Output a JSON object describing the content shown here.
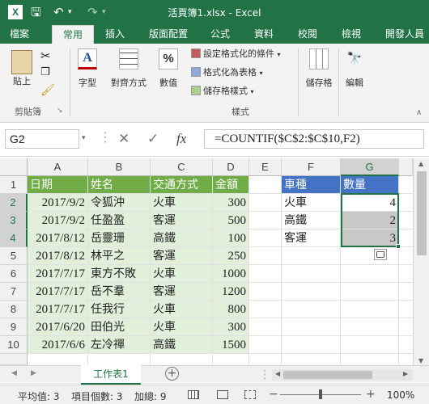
{
  "window": {
    "title": "活頁簿1.xlsx - Excel",
    "app_icon": "X"
  },
  "ribbon_tabs": [
    {
      "label": "檔案"
    },
    {
      "label": "常用"
    },
    {
      "label": "插入"
    },
    {
      "label": "版面配置"
    },
    {
      "label": "公式"
    },
    {
      "label": "資料"
    },
    {
      "label": "校閱"
    },
    {
      "label": "檢視"
    },
    {
      "label": "開發人員"
    }
  ],
  "ribbon": {
    "paste": "貼上",
    "clipboard": "剪貼簿",
    "font": "字型",
    "alignment": "對齊方式",
    "number": "數值",
    "conditional_format": "設定格式化的條件",
    "format_table": "格式化為表格",
    "cell_styles": "儲存格樣式",
    "styles_group": "樣式",
    "cells": "儲存格",
    "editing": "編輯"
  },
  "formula_bar": {
    "name_box": "G2",
    "formula": "=COUNTIF($C$2:$C$10,F2)",
    "fx": "fx"
  },
  "columns": [
    "A",
    "B",
    "C",
    "D",
    "E",
    "F",
    "G"
  ],
  "rows": [
    "1",
    "2",
    "3",
    "4",
    "5",
    "6",
    "7",
    "8",
    "9",
    "10"
  ],
  "table": {
    "headers": [
      "日期",
      "姓名",
      "交通方式",
      "金額"
    ],
    "rows": [
      [
        "2017/9/2",
        "令狐沖",
        "火車",
        "300"
      ],
      [
        "2017/9/2",
        "任盈盈",
        "客運",
        "500"
      ],
      [
        "2017/8/12",
        "岳靈珊",
        "高鐵",
        "100"
      ],
      [
        "2017/8/12",
        "林平之",
        "客運",
        "250"
      ],
      [
        "2017/7/17",
        "東方不敗",
        "火車",
        "1000"
      ],
      [
        "2017/7/17",
        "岳不羣",
        "客運",
        "1200"
      ],
      [
        "2017/7/17",
        "任我行",
        "火車",
        "800"
      ],
      [
        "2017/6/20",
        "田伯光",
        "火車",
        "300"
      ],
      [
        "2017/6/6",
        "左冷禪",
        "高鐵",
        "1500"
      ]
    ]
  },
  "summary": {
    "headers": [
      "車種",
      "數量"
    ],
    "rows": [
      [
        "火車",
        "4"
      ],
      [
        "高鐵",
        "2"
      ],
      [
        "客運",
        "3"
      ]
    ]
  },
  "sheet_tab": "工作表1",
  "status": {
    "average": "平均值: 3",
    "count": "項目個數: 3",
    "sum": "加總: 9",
    "zoom": "100%"
  },
  "colors": {
    "excel_green": "#217346",
    "table_header_green": "#70ad47",
    "table_band": "#e2efda",
    "summary_header_blue": "#4472c4",
    "selection_gray": "#c9c9c9"
  }
}
